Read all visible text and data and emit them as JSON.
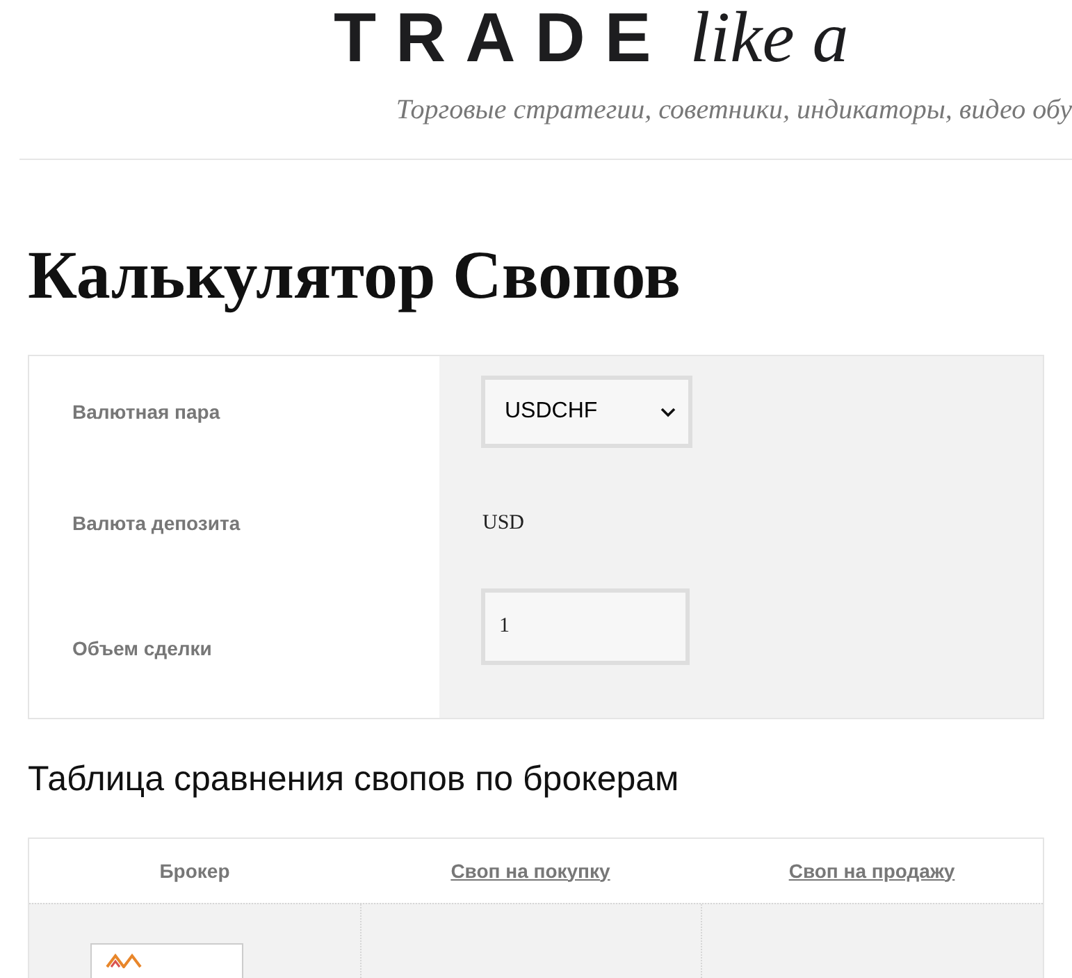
{
  "header": {
    "logo": {
      "word": "TRADE",
      "script": "like a"
    },
    "tagline": "Торговые стратегии, советники, индикаторы, видео обу"
  },
  "page_title": "Калькулятор Свопов",
  "calculator": {
    "rows": [
      {
        "kind": "select",
        "label": "Валютная пара",
        "value": "USDCHF"
      },
      {
        "kind": "text",
        "label": "Валюта депозита",
        "value": "USD"
      },
      {
        "kind": "input",
        "label": "Объем сделки",
        "value": "1"
      }
    ]
  },
  "comparison": {
    "heading": "Таблица сравнения свопов по брокерам",
    "columns": [
      {
        "label": "Брокер",
        "link": false
      },
      {
        "label": "Своп на покупку",
        "link": true
      },
      {
        "label": "Своп на продажу",
        "link": true
      }
    ],
    "rows": [
      {
        "broker_logo": true
      }
    ]
  }
}
